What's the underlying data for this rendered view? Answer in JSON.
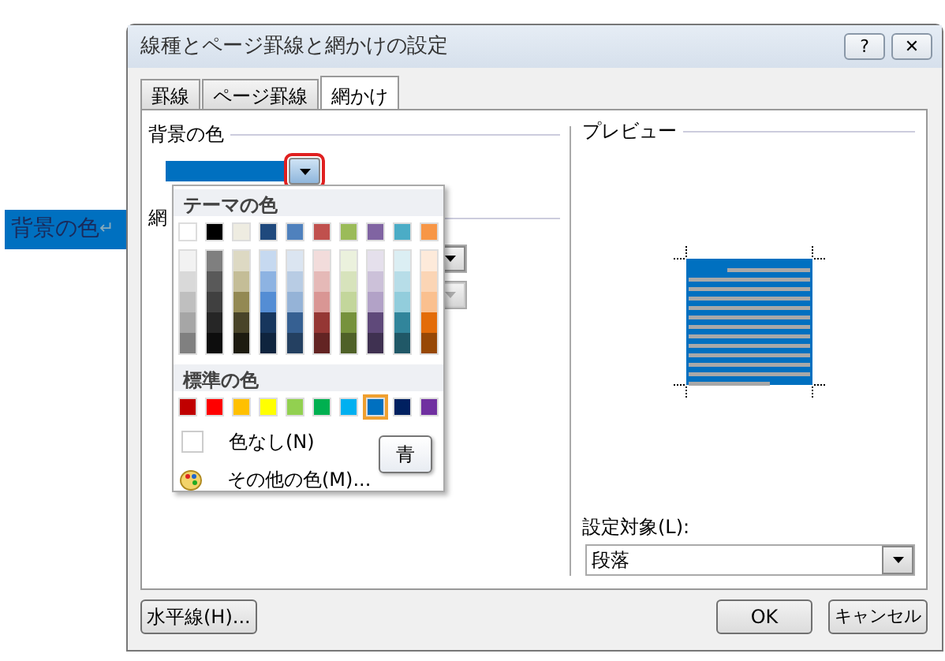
{
  "document": {
    "text": "背景の色",
    "paragraph_mark": "↵"
  },
  "window": {
    "title": "線種とページ罫線と網かけの設定",
    "help": "?",
    "close": "✕"
  },
  "tabs": [
    {
      "label": "罫線",
      "selected": false
    },
    {
      "label": "ページ罫線",
      "selected": false
    },
    {
      "label": "網かけ",
      "selected": true
    }
  ],
  "shading": {
    "background_label": "背景の色",
    "background_swatch": {
      "color": "#0070c0"
    },
    "pattern_label": "網"
  },
  "color_popup": {
    "theme_header": "テーマの色",
    "theme_colors": [
      {
        "color": "#ffffff",
        "tints": [
          {
            "color": "#f2f2f2"
          },
          {
            "color": "#d9d9d9"
          },
          {
            "color": "#bfbfbf"
          },
          {
            "color": "#a6a6a6"
          },
          {
            "color": "#808080"
          }
        ]
      },
      {
        "color": "#000000",
        "tints": [
          {
            "color": "#7f7f7f"
          },
          {
            "color": "#595959"
          },
          {
            "color": "#404040"
          },
          {
            "color": "#262626"
          },
          {
            "color": "#0d0d0d"
          }
        ]
      },
      {
        "color": "#eeece1",
        "tints": [
          {
            "color": "#ddd9c3"
          },
          {
            "color": "#c4bd97"
          },
          {
            "color": "#938953"
          },
          {
            "color": "#494429"
          },
          {
            "color": "#1d1b10"
          }
        ]
      },
      {
        "color": "#1f497d",
        "tints": [
          {
            "color": "#c6d9f0"
          },
          {
            "color": "#8db3e2"
          },
          {
            "color": "#548dd4"
          },
          {
            "color": "#17365d"
          },
          {
            "color": "#0f243e"
          }
        ]
      },
      {
        "color": "#4f81bd",
        "tints": [
          {
            "color": "#dbe5f1"
          },
          {
            "color": "#b8cce4"
          },
          {
            "color": "#95b3d7"
          },
          {
            "color": "#366092"
          },
          {
            "color": "#244061"
          }
        ]
      },
      {
        "color": "#c0504d",
        "tints": [
          {
            "color": "#f2dcdb"
          },
          {
            "color": "#e5b9b7"
          },
          {
            "color": "#d99694"
          },
          {
            "color": "#953734"
          },
          {
            "color": "#632423"
          }
        ]
      },
      {
        "color": "#9bbb59",
        "tints": [
          {
            "color": "#ebf1dd"
          },
          {
            "color": "#d7e3bc"
          },
          {
            "color": "#c3d69b"
          },
          {
            "color": "#76923c"
          },
          {
            "color": "#4f6128"
          }
        ]
      },
      {
        "color": "#8064a2",
        "tints": [
          {
            "color": "#e5e0ec"
          },
          {
            "color": "#ccc1d9"
          },
          {
            "color": "#b2a2c7"
          },
          {
            "color": "#5f497a"
          },
          {
            "color": "#3f3151"
          }
        ]
      },
      {
        "color": "#4bacc6",
        "tints": [
          {
            "color": "#dbeef3"
          },
          {
            "color": "#b7dde8"
          },
          {
            "color": "#92cddc"
          },
          {
            "color": "#31859b"
          },
          {
            "color": "#205867"
          }
        ]
      },
      {
        "color": "#f79646",
        "tints": [
          {
            "color": "#fdeada"
          },
          {
            "color": "#fbd5b5"
          },
          {
            "color": "#fac08f"
          },
          {
            "color": "#e36c09"
          },
          {
            "color": "#974806"
          }
        ]
      }
    ],
    "standard_header": "標準の色",
    "standard_colors": [
      {
        "color": "#c00000",
        "selected": false
      },
      {
        "color": "#ff0000",
        "selected": false
      },
      {
        "color": "#ffc000",
        "selected": false
      },
      {
        "color": "#ffff00",
        "selected": false
      },
      {
        "color": "#92d050",
        "selected": false
      },
      {
        "color": "#00b050",
        "selected": false
      },
      {
        "color": "#00b0f0",
        "selected": false
      },
      {
        "color": "#0070c0",
        "selected": true
      },
      {
        "color": "#002060",
        "selected": false
      },
      {
        "color": "#7030a0",
        "selected": false
      }
    ],
    "no_color": "色なし(N)",
    "more_colors": "その他の色(M)...",
    "tooltip": "青"
  },
  "preview": {
    "label": "プレビュー"
  },
  "apply_to": {
    "label": "設定対象(L):",
    "value": "段落"
  },
  "buttons": {
    "horizontal_line": "水平線(H)...",
    "ok": "OK",
    "cancel": "キャンセル"
  }
}
